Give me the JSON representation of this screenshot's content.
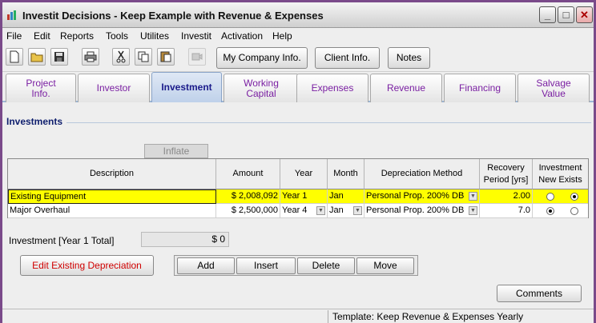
{
  "window": {
    "title": "Investit Decisions  - Keep Example with Revenue & Expenses",
    "min_label": "_",
    "max_label": "□",
    "close_label": "✕"
  },
  "menu": [
    "File",
    "Edit",
    "Reports",
    "Tools",
    "Utilites",
    "Investit",
    "Activation",
    "Help"
  ],
  "toolbar": {
    "icons": [
      "new-icon",
      "open-icon",
      "save-icon",
      "print-icon",
      "cut-icon",
      "copy-icon",
      "paste-icon",
      "camera-icon"
    ],
    "buttons": [
      "My Company Info.",
      "Client Info.",
      "Notes"
    ]
  },
  "tabs": [
    {
      "line1": "Project",
      "line2": "Info."
    },
    {
      "line1": "Investor",
      "line2": ""
    },
    {
      "line1": "Investment",
      "line2": ""
    },
    {
      "line1": "Working",
      "line2": "Capital"
    },
    {
      "line1": "Expenses",
      "line2": ""
    },
    {
      "line1": "Revenue",
      "line2": ""
    },
    {
      "line1": "Financing",
      "line2": ""
    },
    {
      "line1": "Salvage",
      "line2": "Value"
    }
  ],
  "section": {
    "title": "Investments",
    "inflate_label": "Inflate"
  },
  "grid": {
    "headers": {
      "description": "Description",
      "amount": "Amount",
      "year": "Year",
      "month": "Month",
      "depreciation": "Depreciation Method",
      "recovery_1": "Recovery",
      "recovery_2": "Period [yrs]",
      "investment_1": "Investment",
      "investment_2": "New  Exists"
    },
    "rows": [
      {
        "description": "Existing Equipment",
        "amount": "$ 2,008,092",
        "year": "Year 1",
        "month": "Jan",
        "depreciation": "Personal Prop. 200% DB",
        "recovery": "2.00",
        "new": false,
        "exists": true
      },
      {
        "description": "Major Overhaul",
        "amount": "$ 2,500,000",
        "year": "Year 4",
        "month": "Jan",
        "depreciation": "Personal Prop. 200% DB",
        "recovery": "7.0",
        "new": true,
        "exists": false
      }
    ]
  },
  "total": {
    "label": "Investment [Year 1 Total]",
    "value": "$ 0"
  },
  "buttons": {
    "edit_depreciation": "Edit Existing Depreciation",
    "add": "Add",
    "insert": "Insert",
    "delete": "Delete",
    "move": "Move",
    "comments": "Comments"
  },
  "status": {
    "template": "Template: Keep Revenue & Expenses Yearly"
  },
  "colors": {
    "selected_row": "#ffff00",
    "tab_text": "#7a1fa2",
    "active_tab_bg": "#bfd1ea",
    "section_title": "#0f1f6e",
    "edit_button_text": "#d00000",
    "window_border": "#7a4a8a"
  }
}
